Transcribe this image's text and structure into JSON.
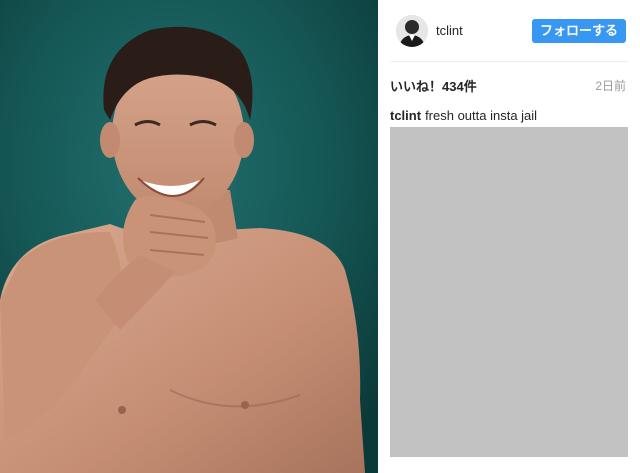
{
  "post": {
    "username": "tclint",
    "follow_label": "フォローする",
    "likes_text": "いいね！434件",
    "time_ago": "2日前",
    "caption_user": "tclint",
    "caption_text": "fresh outta insta jail"
  },
  "colors": {
    "follow_button": "#3897f0",
    "photo_background": "#145654",
    "comments_placeholder": "#c2c2c2"
  },
  "icons": {
    "avatar": "profile-avatar-icon"
  }
}
